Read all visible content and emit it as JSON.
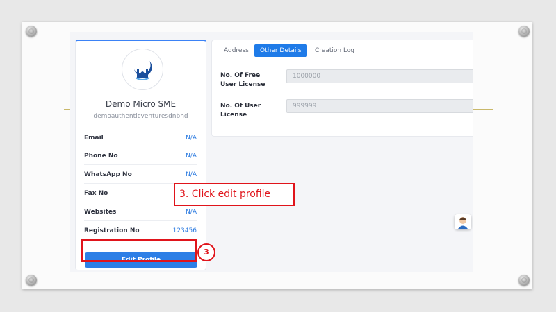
{
  "profile": {
    "org_name": "Demo Micro SME",
    "org_username": "demoauthenticventuresdnbhd",
    "fields": [
      {
        "label": "Email",
        "value": "N/A"
      },
      {
        "label": "Phone No",
        "value": "N/A"
      },
      {
        "label": "WhatsApp No",
        "value": "N/A"
      },
      {
        "label": "Fax No",
        "value": ""
      },
      {
        "label": "Websites",
        "value": "N/A"
      },
      {
        "label": "Registration No",
        "value": "123456"
      }
    ],
    "edit_button": "Edit Profile"
  },
  "tabs": [
    {
      "label": "Address",
      "active": false
    },
    {
      "label": "Other Details",
      "active": true
    },
    {
      "label": "Creation Log",
      "active": false
    }
  ],
  "details": {
    "free_license_label": "No. Of Free User License",
    "free_license_value": "1000000",
    "user_license_label": "No. Of User License",
    "user_license_value": "999999"
  },
  "annotation": {
    "callout_text": "3. Click edit profile",
    "step_number": "3"
  },
  "colors": {
    "accent": "#1f7be8",
    "highlight": "#e0141b",
    "link": "#2f7de1"
  },
  "icons": {
    "logo": "mosque-crescent-logo-icon",
    "support": "support-agent-icon"
  }
}
